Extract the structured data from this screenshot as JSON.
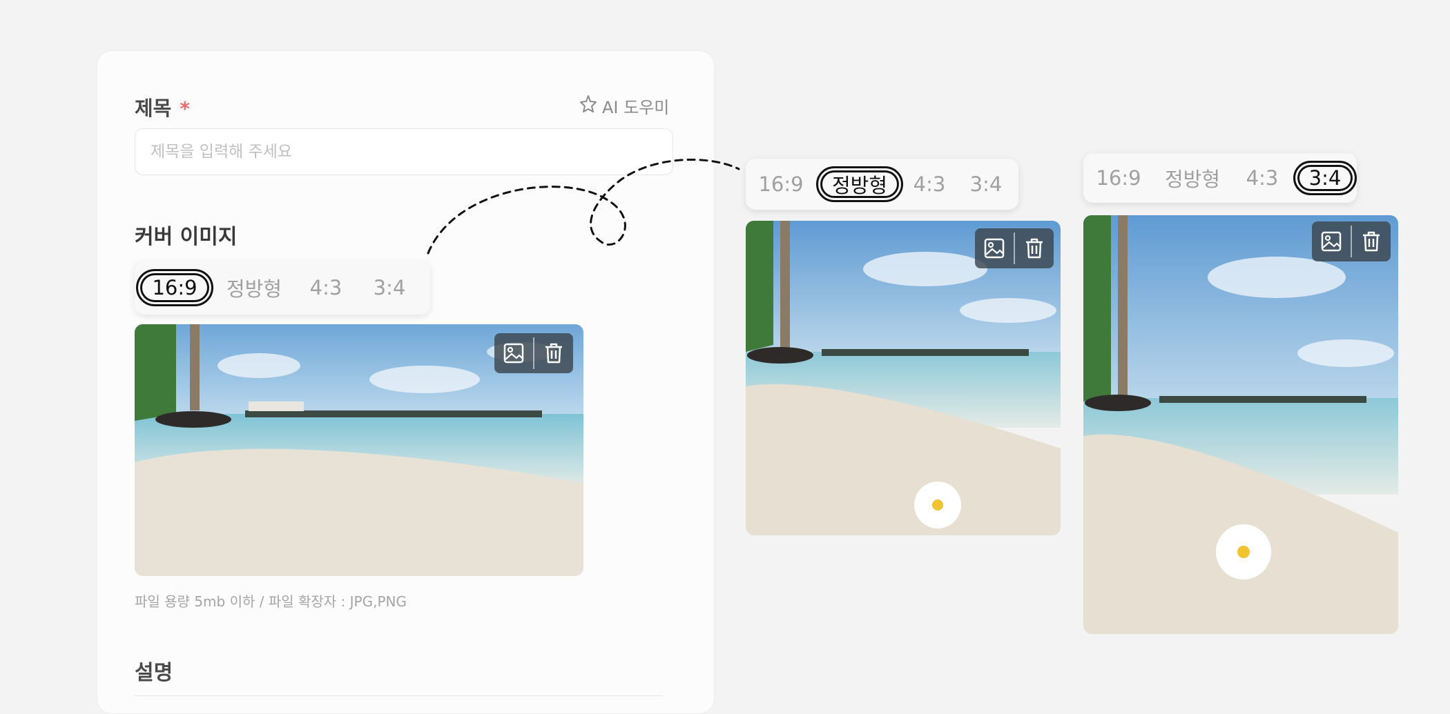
{
  "form": {
    "title_label": "제목",
    "required_mark": "*",
    "ai_button": "AI 도우미",
    "title_placeholder": "제목을 입력해 주세요",
    "cover_label": "커버 이미지",
    "file_hint": "파일 용량 5mb 이하 / 파일 확장자 : JPG,PNG",
    "description_label": "설명"
  },
  "ratio_options": [
    "16:9",
    "정방형",
    "4:3",
    "3:4"
  ],
  "previews": [
    {
      "selected": "16:9"
    },
    {
      "selected": "정방형"
    },
    {
      "selected": "3:4"
    }
  ],
  "icons": {
    "replace": "image-icon",
    "delete": "trash-icon",
    "ai": "sparkle-icon"
  },
  "colors": {
    "background": "#f3f3f3",
    "required": "#ef6b6b",
    "selected_outline": "#111111"
  }
}
